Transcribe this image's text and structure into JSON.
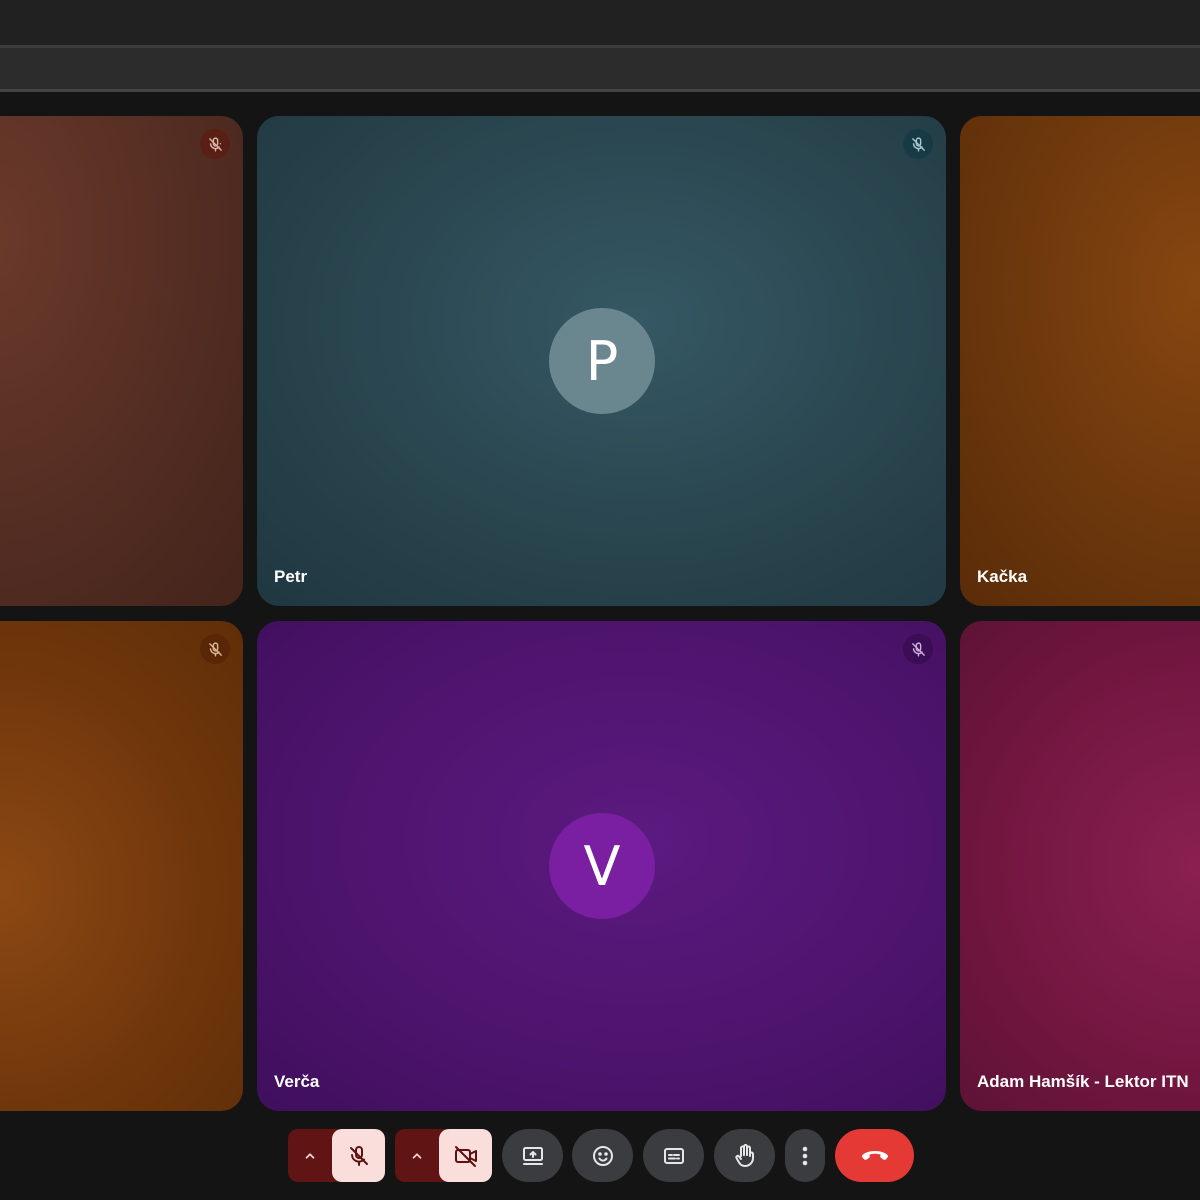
{
  "colors": {
    "background": "#141414",
    "end_call": "#e53935",
    "muted_control_bg": "#601414",
    "muted_control_fg": "#f9dedc",
    "control_bg": "#3a3c3f"
  },
  "participants": [
    {
      "name": "",
      "initial": "",
      "muted": true,
      "mic_icon": "mic-off-icon"
    },
    {
      "name": "Petr",
      "initial": "P",
      "muted": true,
      "mic_icon": "mic-off-icon",
      "avatar_color": "#6a8790"
    },
    {
      "name": "Kačka",
      "initial": "",
      "muted": false
    },
    {
      "name": "",
      "initial": "",
      "muted": true,
      "mic_icon": "mic-off-icon"
    },
    {
      "name": "Verča",
      "initial": "V",
      "muted": true,
      "mic_icon": "mic-off-icon",
      "avatar_color": "#7a1fa2"
    },
    {
      "name": "Adam Hamšík - Lektor ITN",
      "initial": "",
      "muted": false
    }
  ],
  "controls": {
    "mic": {
      "icon": "mic-off-icon",
      "options_icon": "chevron-up-icon",
      "state": "muted"
    },
    "camera": {
      "icon": "camera-off-icon",
      "options_icon": "chevron-up-icon",
      "state": "off"
    },
    "present": {
      "icon": "present-screen-icon"
    },
    "reactions": {
      "icon": "emoji-icon"
    },
    "captions": {
      "icon": "captions-icon"
    },
    "raise_hand": {
      "icon": "hand-icon"
    },
    "more": {
      "icon": "more-vert-icon"
    },
    "end_call": {
      "icon": "hangup-icon"
    }
  }
}
